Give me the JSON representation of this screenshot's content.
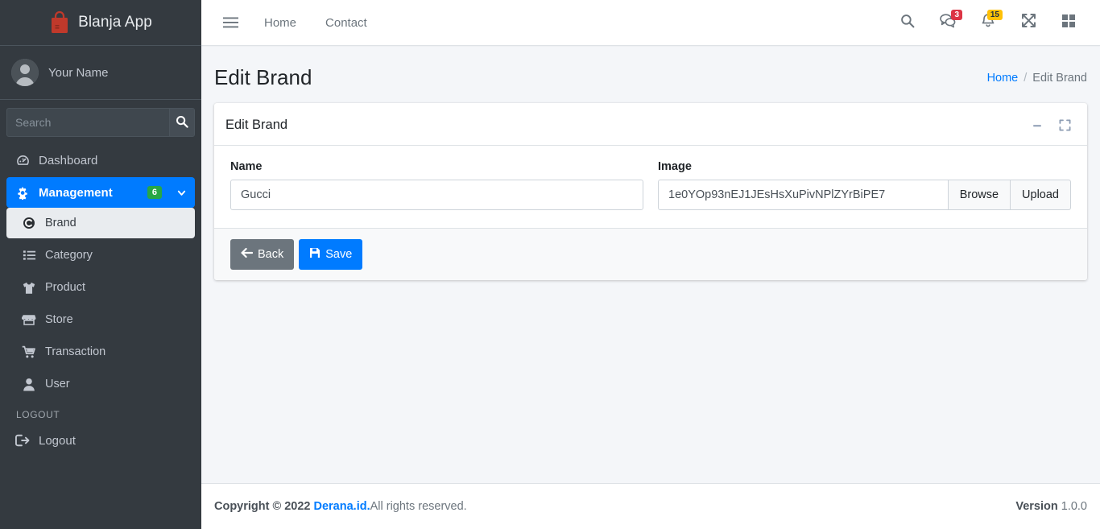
{
  "sidebar": {
    "brand": {
      "label": "Blanja App",
      "logo_icon": "shopping-bag-icon"
    },
    "user": {
      "name": "Your Name",
      "avatar_icon": "user-avatar"
    },
    "search": {
      "placeholder": "Search",
      "value": "",
      "button_icon": "search-icon"
    },
    "items": [
      {
        "label": "Dashboard",
        "icon": "dashboard-gauge-icon",
        "state": "normal"
      },
      {
        "label": "Management",
        "icon": "gear-icon",
        "state": "active",
        "badge": "6",
        "chevron": "chevron-down-icon"
      },
      {
        "label": "Brand",
        "icon": "circle-c-icon",
        "state": "sub-active"
      },
      {
        "label": "Category",
        "icon": "list-icon",
        "state": "sub"
      },
      {
        "label": "Product",
        "icon": "tshirt-icon",
        "state": "sub"
      },
      {
        "label": "Store",
        "icon": "store-icon",
        "state": "sub"
      },
      {
        "label": "Transaction",
        "icon": "shopping-cart-icon",
        "state": "sub"
      },
      {
        "label": "User",
        "icon": "user-icon",
        "state": "sub"
      }
    ],
    "logout_header": "LOGOUT",
    "logout": {
      "label": "Logout",
      "icon": "sign-out-icon"
    }
  },
  "topnav": {
    "menu_icon": "hamburger-menu-icon",
    "links": [
      {
        "label": "Home"
      },
      {
        "label": "Contact"
      }
    ],
    "icons": [
      {
        "name": "search-icon",
        "badge": null
      },
      {
        "name": "comments-icon",
        "badge": "3",
        "badge_color": "#dc3545"
      },
      {
        "name": "bell-icon",
        "badge": "15",
        "badge_color": "#ffc107"
      },
      {
        "name": "expand-arrows-icon",
        "badge": null
      },
      {
        "name": "grid-apps-icon",
        "badge": null
      }
    ]
  },
  "content_header": {
    "title": "Edit Brand",
    "breadcrumb": {
      "home": "Home",
      "separator": "/",
      "current": "Edit Brand"
    }
  },
  "card": {
    "title": "Edit Brand",
    "tools": [
      {
        "name": "minimize-icon"
      },
      {
        "name": "maximize-icon"
      }
    ],
    "fields": {
      "name": {
        "label": "Name",
        "value": "Gucci"
      },
      "image": {
        "label": "Image",
        "value": "1e0YOp93nEJ1JEsHsXuPivNPlZYrBiPE7",
        "browse_label": "Browse",
        "upload_label": "Upload"
      }
    },
    "footer": {
      "back_label": "Back",
      "back_icon": "arrow-left-icon",
      "save_label": "Save",
      "save_icon": "save-floppy-icon"
    }
  },
  "footer": {
    "copyright_prefix": "Copyright © 2022",
    "brand_link": "Derana.id.",
    "rights": "All rights reserved.",
    "version_label": "Version",
    "version_value": "1.0.0"
  },
  "colors": {
    "sidebar_bg": "#343a40",
    "accent": "#007bff",
    "badge_green": "#28a745",
    "badge_red": "#dc3545",
    "badge_yellow": "#ffc107",
    "logo_red": "#c0392b",
    "page_bg": "#f4f6f9"
  }
}
